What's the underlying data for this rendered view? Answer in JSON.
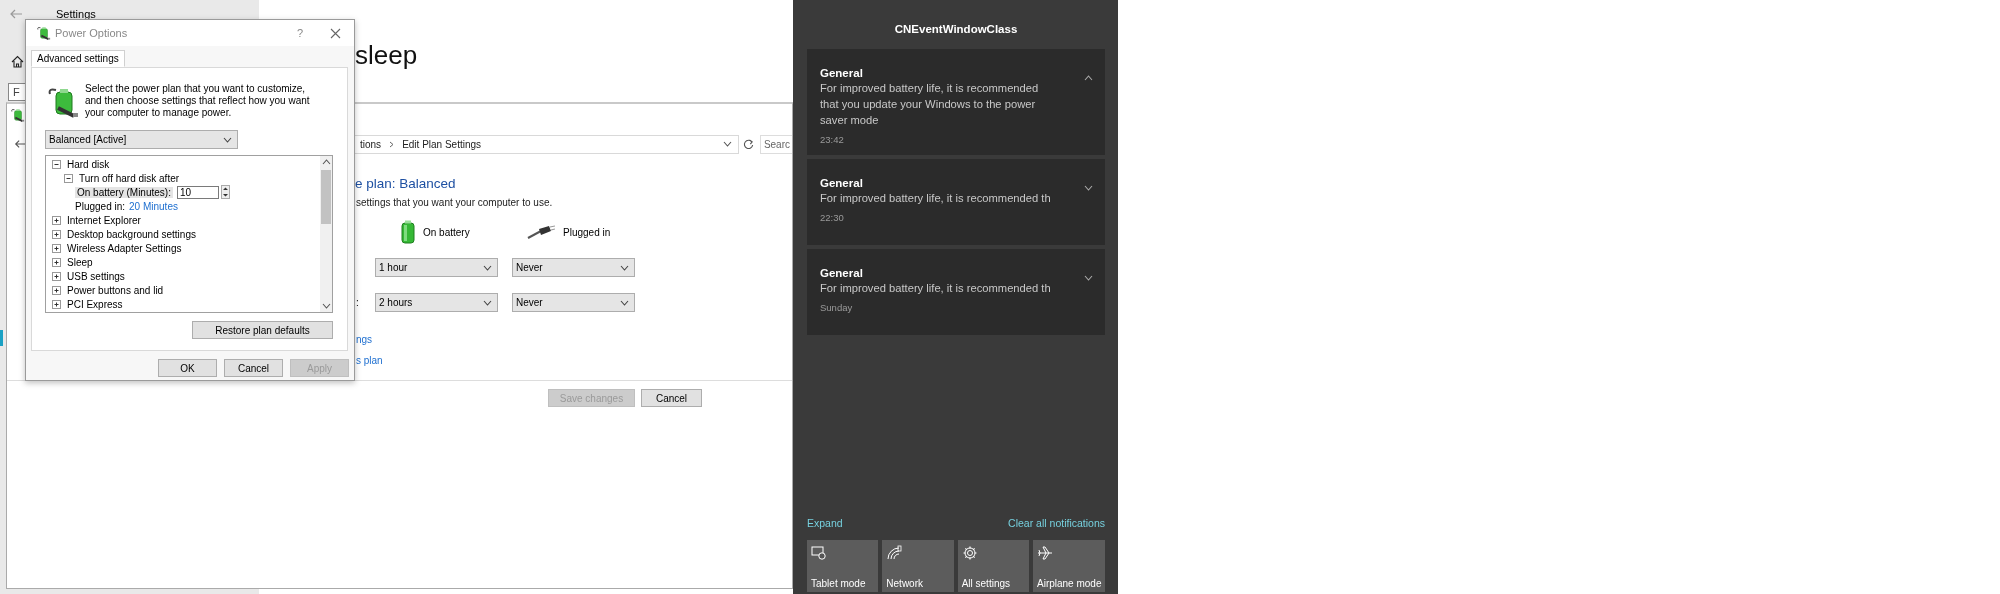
{
  "settings_window": {
    "title": "Settings",
    "search_value": "F",
    "heading": "sleep"
  },
  "control_panel": {
    "breadcrumb": [
      "tions",
      "Edit Plan Settings"
    ],
    "search_placeholder": "Searc",
    "heading": "e plan: Balanced",
    "description": "settings that you want your computer to use.",
    "columns": [
      "On battery",
      "Plugged in"
    ],
    "rows": [
      {
        "label": "",
        "values": [
          "1 hour",
          "Never"
        ]
      },
      {
        "label": ":",
        "values": [
          "2 hours",
          "Never"
        ]
      }
    ],
    "links": [
      "ngs",
      "s plan"
    ],
    "buttons": [
      {
        "label": "Save changes",
        "disabled": true
      },
      {
        "label": "Cancel",
        "disabled": false
      }
    ]
  },
  "power_options": {
    "title": "Power Options",
    "help": "?",
    "tabs": [
      {
        "label": "Advanced settings",
        "selected": true
      }
    ],
    "description": "Select the power plan that you want to customize, and then choose settings that reflect how you want your computer to manage power.",
    "plan": "Balanced [Active]",
    "tree": [
      {
        "label": "Hard disk",
        "expanded": true,
        "children": [
          {
            "label": "Turn off hard disk after",
            "expanded": true,
            "children": [
              {
                "kind": "spin",
                "label": "On battery (Minutes):",
                "value": "10"
              },
              {
                "kind": "value",
                "label": "Plugged in:",
                "value": "20 Minutes"
              }
            ]
          }
        ]
      },
      {
        "label": "Internet Explorer",
        "expanded": false
      },
      {
        "label": "Desktop background settings",
        "expanded": false
      },
      {
        "label": "Wireless Adapter Settings",
        "expanded": false
      },
      {
        "label": "Sleep",
        "expanded": false
      },
      {
        "label": "USB settings",
        "expanded": false
      },
      {
        "label": "Power buttons and lid",
        "expanded": false
      },
      {
        "label": "PCI Express",
        "expanded": false
      }
    ],
    "restore_button": "Restore plan defaults",
    "buttons": [
      {
        "label": "OK",
        "disabled": false
      },
      {
        "label": "Cancel",
        "disabled": false
      },
      {
        "label": "Apply",
        "disabled": true
      }
    ]
  },
  "action_center": {
    "title": "CNEventWindowClass",
    "notifications": [
      {
        "title": "General",
        "body": "For improved battery life, it is recommended that you update your Windows to the power saver mode",
        "time": "23:42",
        "expanded": true
      },
      {
        "title": "General",
        "body": "For improved battery life, it is recommended th",
        "time": "22:30",
        "expanded": false
      },
      {
        "title": "General",
        "body": "For improved battery life, it is recommended th",
        "time": "Sunday",
        "expanded": false
      }
    ],
    "expand_link": "Expand",
    "clear_link": "Clear all notifications",
    "quick_actions": [
      {
        "kind": "tablet",
        "label": "Tablet mode"
      },
      {
        "kind": "network",
        "label": "Network"
      },
      {
        "kind": "settings",
        "label": "All settings"
      },
      {
        "kind": "airplane",
        "label": "Airplane mode"
      }
    ]
  }
}
